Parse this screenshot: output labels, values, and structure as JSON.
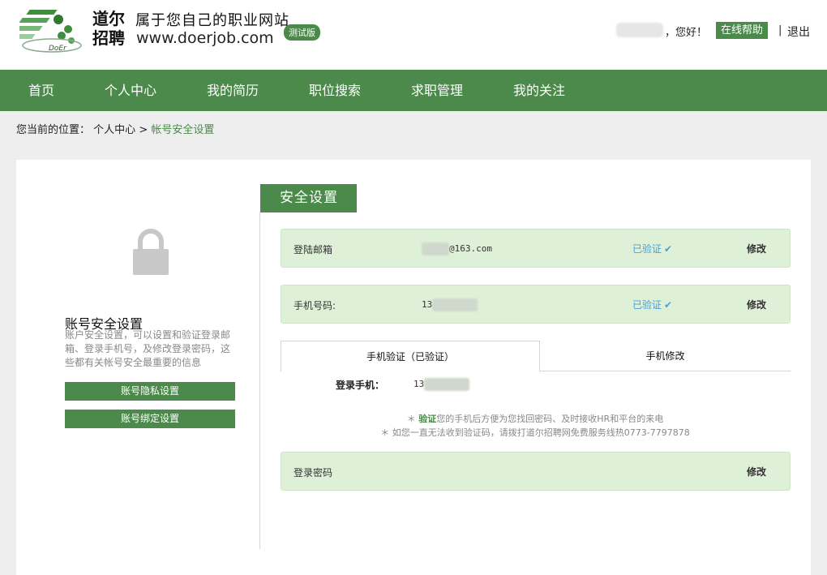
{
  "header": {
    "brand_cn_1": "道尔",
    "brand_cn_2": "招聘",
    "slogan": "属于您自己的职业网站",
    "domain": "www.doerjob.com",
    "beta_badge": "测试版",
    "greeting": "，您好！",
    "help_label": "在线帮助",
    "separator": "|",
    "logout_label": "退出",
    "logo_text": "DoEr"
  },
  "nav": {
    "items": [
      "首页",
      "个人中心",
      "我的简历",
      "职位搜索",
      "求职管理",
      "我的关注"
    ]
  },
  "breadcrumb": {
    "prefix": "您当前的位置：",
    "parent": "个人中心",
    "arrow": ">",
    "current": "帐号安全设置"
  },
  "sidebar": {
    "title": "账号安全设置",
    "description": "账户安全设置，可以设置和验证登录邮箱、登录手机号，及修改登录密码，这些都有关帐号安全最重要的信息",
    "buttons": [
      "账号隐私设置",
      "账号绑定设置"
    ]
  },
  "security": {
    "tab_title": "安全设置",
    "email": {
      "label": "登陆邮箱",
      "value_suffix": "@163.com",
      "status": "已验证",
      "edit": "修改"
    },
    "phone": {
      "label": "手机号码:",
      "value_prefix": "13",
      "status": "已验证",
      "edit": "修改"
    },
    "sub_tabs": [
      "手机验证（已验证）",
      "手机修改"
    ],
    "login_phone_label": "登录手机：",
    "login_phone_prefix": "13",
    "note_1_star": "＊",
    "note_1_bold": "验证",
    "note_1_rest": "您的手机后方便为您找回密码、及时接收HR和平台的来电",
    "note_2": "＊ 如您一直无法收到验证码，请拨打道尔招聘网免费服务线热0773-7797878",
    "password": {
      "label": "登录密码",
      "edit": "修改"
    }
  },
  "colors": {
    "brand_green": "#4b8a4a",
    "row_bg": "#dff0d8",
    "verified_blue": "#4da0cf"
  }
}
